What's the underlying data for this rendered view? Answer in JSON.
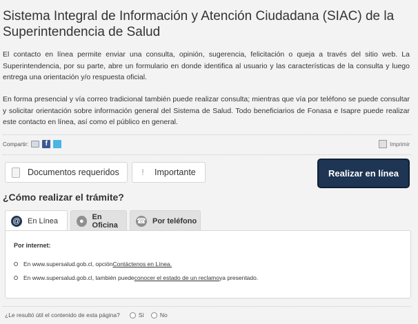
{
  "header": {
    "title": "Sistema Integral de Información y Atención Ciudadana (SIAC) de la Superintendencia de Salud"
  },
  "intro": {
    "p1": "El contacto en línea permite enviar una consulta, opinión, sugerencia, felicitación o queja a través del sitio web. La Superintendencia, por su parte, abre un formulario en donde identifica al usuario y las características de la consulta y luego entrega una orientación y/o respuesta oficial.",
    "p2": "En forma presencial y vía correo tradicional también puede realizar consulta; mientras que vía por teléfono se puede consultar y solicitar orientación sobre información general del Sistema de Salud. Todo beneficiarios de Fonasa e Isapre puede realizar este contacto en línea, así como el público en general."
  },
  "share": {
    "label": "Compartir:",
    "icons": [
      "mail-icon",
      "facebook-icon",
      "twitter-icon"
    ],
    "facebook_glyph": "f"
  },
  "print": {
    "label": "Imprimir"
  },
  "actions": {
    "documents": "Documentos requeridos",
    "important": "Importante",
    "important_glyph": "!",
    "online": "Realizar en línea"
  },
  "how": {
    "title": "¿Cómo realizar el trámite?"
  },
  "tabs": [
    {
      "label": "En Línea",
      "glyph": "@"
    },
    {
      "label": "En Oficina",
      "glyph": "●"
    },
    {
      "label": "Por teléfono",
      "glyph": "☎"
    }
  ],
  "panel": {
    "heading": "Por internet:",
    "item1": {
      "prefix": "En www.supersalud.gob.cl, opción ",
      "link": "Contáctenos en Línea."
    },
    "item2": {
      "prefix": "En www.supersalud.gob.cl, también puede ",
      "link": "conocer el estado de un reclamo",
      "suffix": " ya presentado."
    }
  },
  "feedback": {
    "question": "¿Le resultó útil el contenido de esta página?",
    "yes": "Sí",
    "no": "No"
  },
  "colors": {
    "primary": "#1e3553",
    "background": "#f3f3f3",
    "facebook": "#3b5998",
    "twitter": "#49b6e4"
  }
}
